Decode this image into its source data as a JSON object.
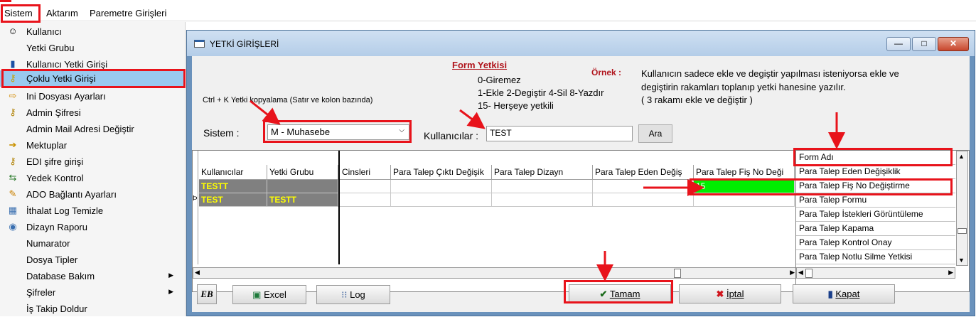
{
  "menubar": {
    "items": [
      "Sistem",
      "Aktarım",
      "Paremetre Girişleri"
    ]
  },
  "sidemenu": {
    "items": [
      {
        "label": "Kullanıcı",
        "icon": "user-icon"
      },
      {
        "label": "Yetki Grubu",
        "icon": ""
      },
      {
        "label": "Kullanıcı Yetki Girişi",
        "icon": "user-permission-icon"
      },
      {
        "label": "Çoklu Yetki Girişi",
        "icon": "key-icon"
      },
      {
        "label": "Ini Dosyası  Ayarları",
        "icon": "settings-file-icon"
      },
      {
        "label": "Admin Şifresi",
        "icon": "key-icon"
      },
      {
        "label": "Admin Mail Adresi Değiştir",
        "icon": ""
      },
      {
        "label": "Mektuplar",
        "icon": "arrow-icon"
      },
      {
        "label": "EDI şifre girişi",
        "icon": "key-icon"
      },
      {
        "label": "Yedek Kontrol",
        "icon": "backup-icon"
      },
      {
        "label": "ADO Bağlantı Ayarları",
        "icon": "connection-icon"
      },
      {
        "label": "İthalat Log Temizle",
        "icon": "clean-icon"
      },
      {
        "label": "Dizayn Raporu",
        "icon": "report-icon"
      },
      {
        "label": "Numarator",
        "icon": ""
      },
      {
        "label": "Dosya Tipler",
        "icon": ""
      },
      {
        "label": "Database Bakım",
        "icon": "",
        "submenu": true
      },
      {
        "label": "Şifreler",
        "icon": "",
        "submenu": true
      },
      {
        "label": "İş Takip Doldur",
        "icon": ""
      }
    ]
  },
  "window": {
    "title": "YETKİ GİRİŞLERİ",
    "controls": [
      "—",
      "□",
      "✕"
    ]
  },
  "form": {
    "heading": "Form Yetkisi",
    "legend": [
      "0-Giremez",
      "1-Ekle  2-Degiştir  4-Sil  8-Yazdır",
      "15- Herşeye yetkili"
    ],
    "example_label": "Örnek :",
    "example_text": [
      "Kullanıcın sadece ekle ve degiştir yapılması isteniyorsa  ekle ve",
      "degiştirin rakamları toplanıp yetki hanesine yazılır.",
      " ( 3 rakamı ekle ve değiştir )"
    ],
    "hint": "Ctrl + K Yetki kopyalama (Satır ve kolon bazında)",
    "sistem_label": "Sistem :",
    "sistem_value": "M - Muhasebe",
    "kullanicilar_label": "Kullanıcılar :",
    "kullanicilar_value": "TEST",
    "ara_button": "Ara"
  },
  "grid": {
    "columns": [
      "Kullanıcılar",
      "Yetki Grubu",
      "Cinsleri",
      "Para Talep Çıktı Değişik",
      "Para Talep Dizayn",
      "Para Talep Eden Değiş",
      "Para Talep Fiş No Deği"
    ],
    "rows": [
      [
        "TESTT",
        "",
        "",
        "",
        "",
        "",
        "15"
      ],
      [
        "TEST",
        "TESTT",
        "",
        "",
        "",
        "",
        ""
      ]
    ],
    "row_marker": "Þ"
  },
  "formlist": {
    "header": "Form Adı",
    "items": [
      "Para Talep Eden Değişiklik",
      "Para Talep Fiş No Değiştirme",
      "Para Talep Formu",
      "Para Talep İstekleri Görüntüleme",
      "Para Talep Kapama",
      "Para Talep Kontrol Onay",
      "Para Talep Notlu Silme Yetkisi"
    ]
  },
  "buttons": {
    "logo": "EB",
    "excel": "Excel",
    "log": "Log",
    "tamam": "Tamam",
    "iptal": "İptal",
    "kapat": "Kapat"
  },
  "colors": {
    "highlight": "#e8131b",
    "grid_dark": "#808080",
    "grid_yellow": "#ffff00",
    "cell_green": "#00ee00",
    "menu_selected": "#99c9ef"
  }
}
